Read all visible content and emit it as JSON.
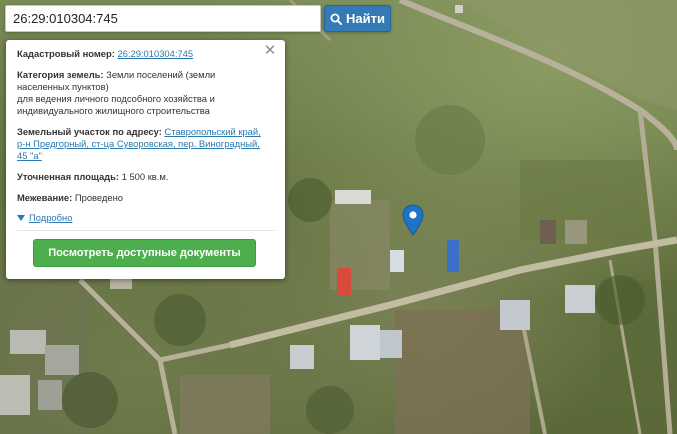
{
  "search": {
    "value": "26:29:010304:745",
    "button_label": "Найти"
  },
  "popup": {
    "cadastral_label": "Кадастровый номер:",
    "cadastral_value": "26:29:010304:745",
    "category_label": "Категория земель:",
    "category_value_line1": "Земли поселений (земли",
    "category_value_line2": "населенных пунктов)",
    "usage_line1": "для ведения личного подсобного хозяйства и",
    "usage_line2": "индивидуального жилищного строительства",
    "address_label": "Земельный участок по адресу:",
    "address_line1": "Ставропольский край,",
    "address_line2": "р-н Предгорный, ст-ца Суворовская, пер. Виноградный,",
    "address_line3": "45 \"а\"",
    "area_label": "Уточненная площадь:",
    "area_value": "1 500 кв.м.",
    "survey_label": "Межевание:",
    "survey_value": "Проведено",
    "more_link": "Подробно",
    "docs_button": "Посмотреть доступные документы"
  },
  "colors": {
    "search_button": "#337ab7",
    "docs_button": "#4cae4c",
    "link": "#2a7ab0",
    "marker": "#1e74c4"
  },
  "icons": {
    "search_button_icon": "magnifier-icon",
    "close": "close-icon",
    "marker": "map-pin-icon",
    "more": "triangle-down-icon"
  }
}
